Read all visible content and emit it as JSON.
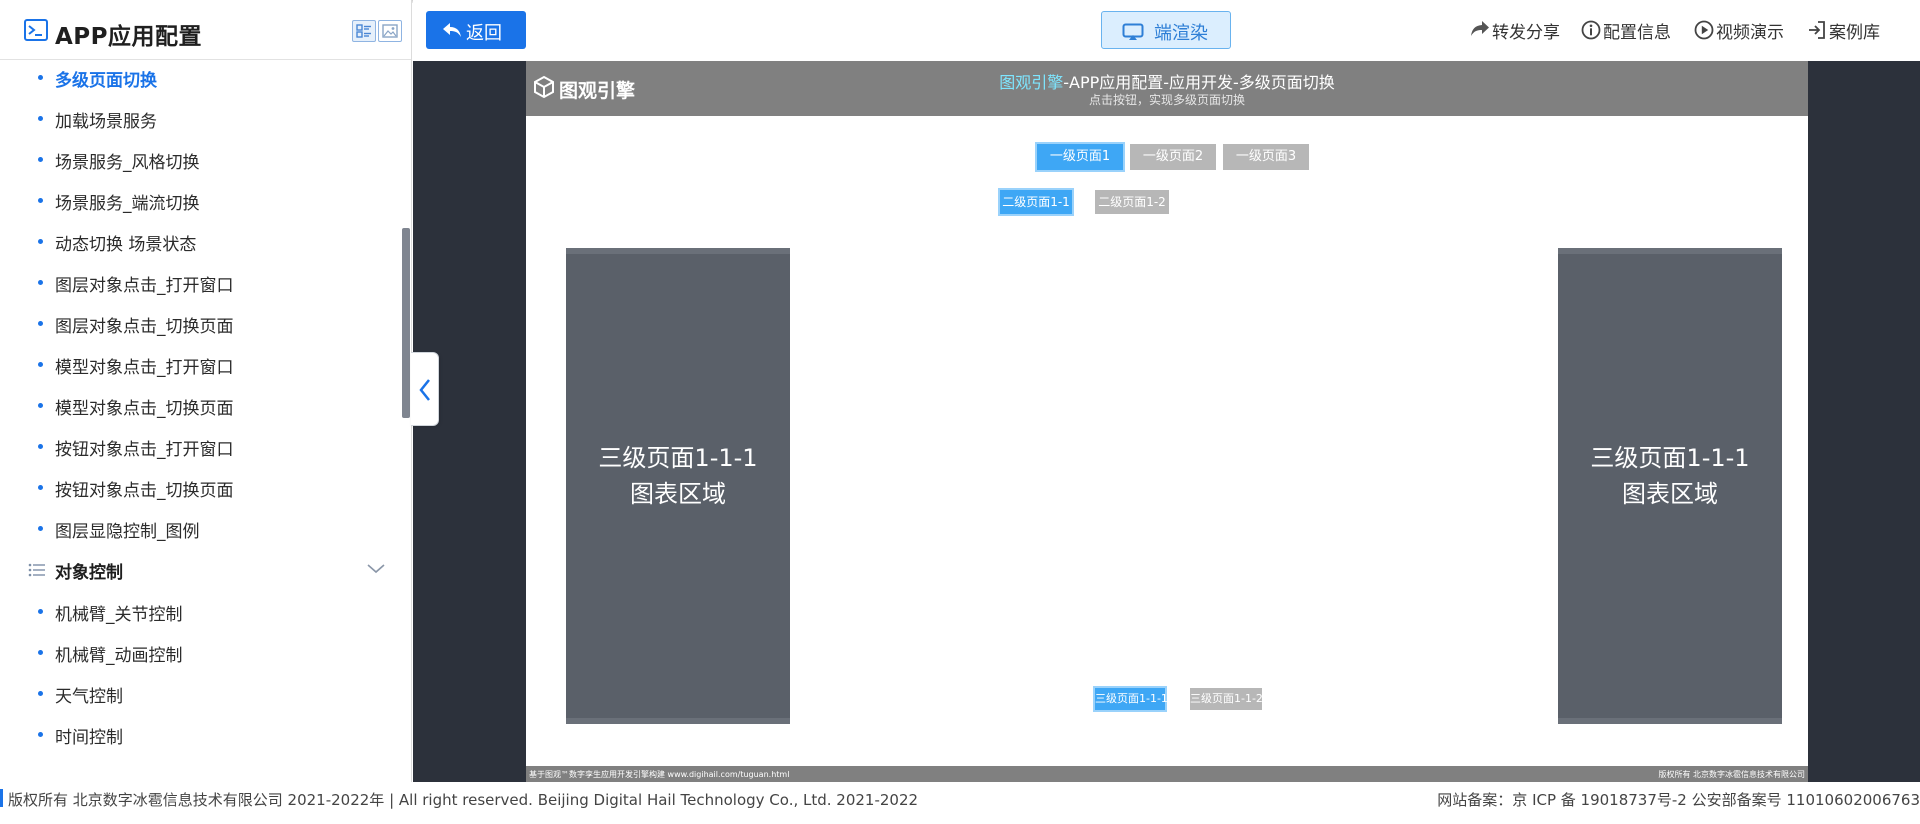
{
  "sidebar": {
    "title": "APP应用配置",
    "items_top": [
      {
        "label": "多级页面切换",
        "active": true
      },
      {
        "label": "加载场景服务"
      },
      {
        "label": "场景服务_风格切换"
      },
      {
        "label": "场景服务_端流切换"
      },
      {
        "label": "动态切换 场景状态"
      },
      {
        "label": "图层对象点击_打开窗口"
      },
      {
        "label": "图层对象点击_切换页面"
      },
      {
        "label": "模型对象点击_打开窗口"
      },
      {
        "label": "模型对象点击_切换页面"
      },
      {
        "label": "按钮对象点击_打开窗口"
      },
      {
        "label": "按钮对象点击_切换页面"
      },
      {
        "label": "图层显隐控制_图例"
      }
    ],
    "group": {
      "label": "对象控制"
    },
    "items_bottom": [
      {
        "label": "机械臂_关节控制"
      },
      {
        "label": "机械臂_动画控制"
      },
      {
        "label": "天气控制"
      },
      {
        "label": "时间控制"
      }
    ]
  },
  "toolbar": {
    "back_label": "返回",
    "render_label": "端渲染",
    "share_label": "转发分享",
    "config_label": "配置信息",
    "video_label": "视频演示",
    "cases_label": "案例库"
  },
  "app": {
    "brand": "图观引擎",
    "title_highlight": "图观引擎",
    "title_rest": "-APP应用配置-应用开发-多级页面切换",
    "subtitle": "点击按钮，实现多级页面切换",
    "level1": [
      "一级页面1",
      "一级页面2",
      "一级页面3"
    ],
    "level2": [
      "二级页面1-1",
      "二级页面1-2"
    ],
    "level3": [
      "三级页面1-1-1",
      "三级页面1-1-2"
    ],
    "panel_left": {
      "line1": "三级页面1-1-1",
      "line2": "图表区域"
    },
    "panel_right": {
      "line1": "三级页面1-1-1",
      "line2": "图表区域"
    },
    "footer_left": "基于图观™数字孪生应用开发引擎构建 www.digihail.com/tuguan.html",
    "footer_right": "版权所有 北京数字冰雹信息技术有限公司"
  },
  "footer": {
    "copyright": "版权所有 北京数字冰雹信息技术有限公司 2021-2022年 | All right reserved. Beijing Digital Hail Technology Co., Ltd. 2021-2022",
    "icp": "网站备案：京 ICP 备 19018737号-2 公安部备案号 11010602006763"
  },
  "colors": {
    "accent": "#1a73e8",
    "active_page_button": "#3ea7f5",
    "inactive_page_button": "#b7b7b7",
    "stage_background": "#2c313b",
    "app_header": "#808080",
    "panel": "#5a6069"
  }
}
